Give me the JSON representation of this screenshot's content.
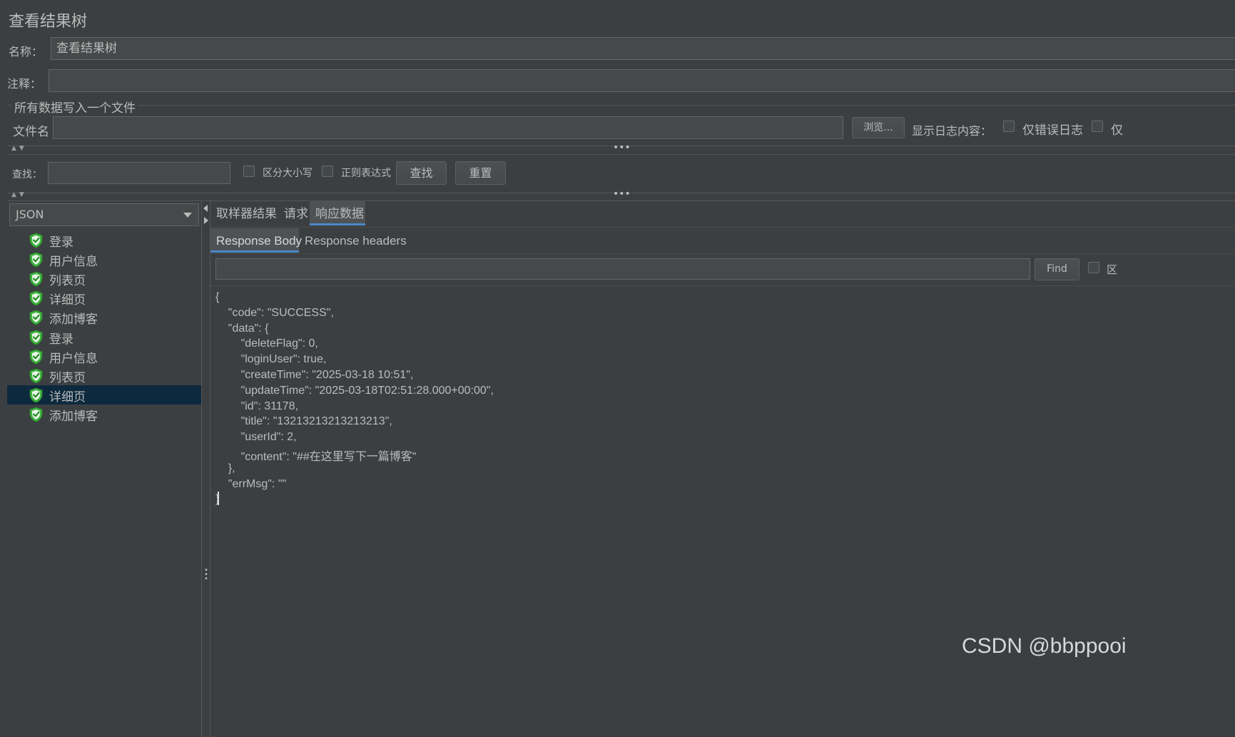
{
  "panel_title": "查看结果树",
  "name_label": "名称：",
  "name_value": "查看结果树",
  "comment_label": "注释：",
  "comment_value": "",
  "file_section_label": "所有数据写入一个文件",
  "filename_label": "文件名",
  "filename_value": "",
  "browse_label": "浏览...",
  "log_display_label": "显示日志内容：",
  "errors_only_label": "仅错误日志",
  "success_only_label": "仅",
  "search": {
    "label": "查找：",
    "value": "",
    "case_sensitive_label": "区分大小写",
    "regex_label": "正则表达式",
    "find_label": "查找",
    "reset_label": "重置"
  },
  "renderer_selected": "JSON",
  "tree_items": [
    {
      "label": "登录",
      "status": "success"
    },
    {
      "label": "用户信息",
      "status": "success"
    },
    {
      "label": "列表页",
      "status": "success"
    },
    {
      "label": "详细页",
      "status": "success"
    },
    {
      "label": "添加博客",
      "status": "success"
    },
    {
      "label": "登录",
      "status": "success"
    },
    {
      "label": "用户信息",
      "status": "success"
    },
    {
      "label": "列表页",
      "status": "success"
    },
    {
      "label": "详细页",
      "status": "success",
      "selected": true
    },
    {
      "label": "添加博客",
      "status": "success"
    }
  ],
  "result_tabs": [
    "取样器结果",
    "请求",
    "响应数据"
  ],
  "active_result_tab": "响应数据",
  "response_tabs": [
    "Response Body",
    "Response headers"
  ],
  "active_response_tab": "Response Body",
  "body_search_value": "",
  "body_find_label": "Find",
  "body_case_label": "区",
  "response_lines": [
    "{",
    "    \"code\": \"SUCCESS\",",
    "    \"data\": {",
    "        \"deleteFlag\": 0,",
    "        \"loginUser\": true,",
    "        \"createTime\": \"2025-03-18 10:51\",",
    "        \"updateTime\": \"2025-03-18T02:51:28.000+00:00\",",
    "        \"id\": 31178,",
    "        \"title\": \"13213213213213213\",",
    "        \"userId\": 2,",
    "        \"content\": \"##在这里写下一篇博客\"",
    "    },",
    "    \"errMsg\": \"\"",
    "}"
  ],
  "watermark": "CSDN @bbppooi",
  "colors": {
    "background": "#3c3f41",
    "field": "#45494a",
    "selection": "#0d293e",
    "tab_accent": "#4a88c7",
    "success_icon": "#3fb33f"
  }
}
